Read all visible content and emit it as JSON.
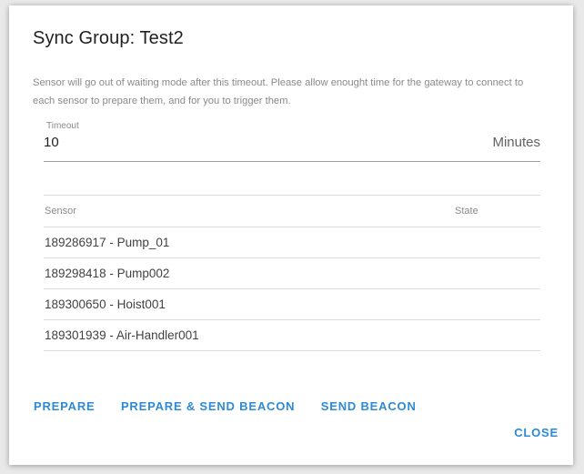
{
  "dialog": {
    "title": "Sync Group: Test2",
    "description": "Sensor will go out of waiting mode after this timeout. Please allow enought time for the gateway to connect to each sensor to prepare them, and for you to trigger them.",
    "timeout": {
      "label": "Timeout",
      "value": "10",
      "suffix": "Minutes"
    },
    "table": {
      "headers": {
        "sensor": "Sensor",
        "state": "State"
      },
      "rows": [
        {
          "sensor": "189286917 - Pump_01",
          "state": ""
        },
        {
          "sensor": "189298418 - Pump002",
          "state": ""
        },
        {
          "sensor": "189300650 - Hoist001",
          "state": ""
        },
        {
          "sensor": "189301939 - Air-Handler001",
          "state": ""
        }
      ]
    },
    "actions": {
      "prepare": "PREPARE",
      "prepare_send_beacon": "PREPARE & SEND BEACON",
      "send_beacon": "SEND BEACON"
    },
    "close": "CLOSE"
  }
}
